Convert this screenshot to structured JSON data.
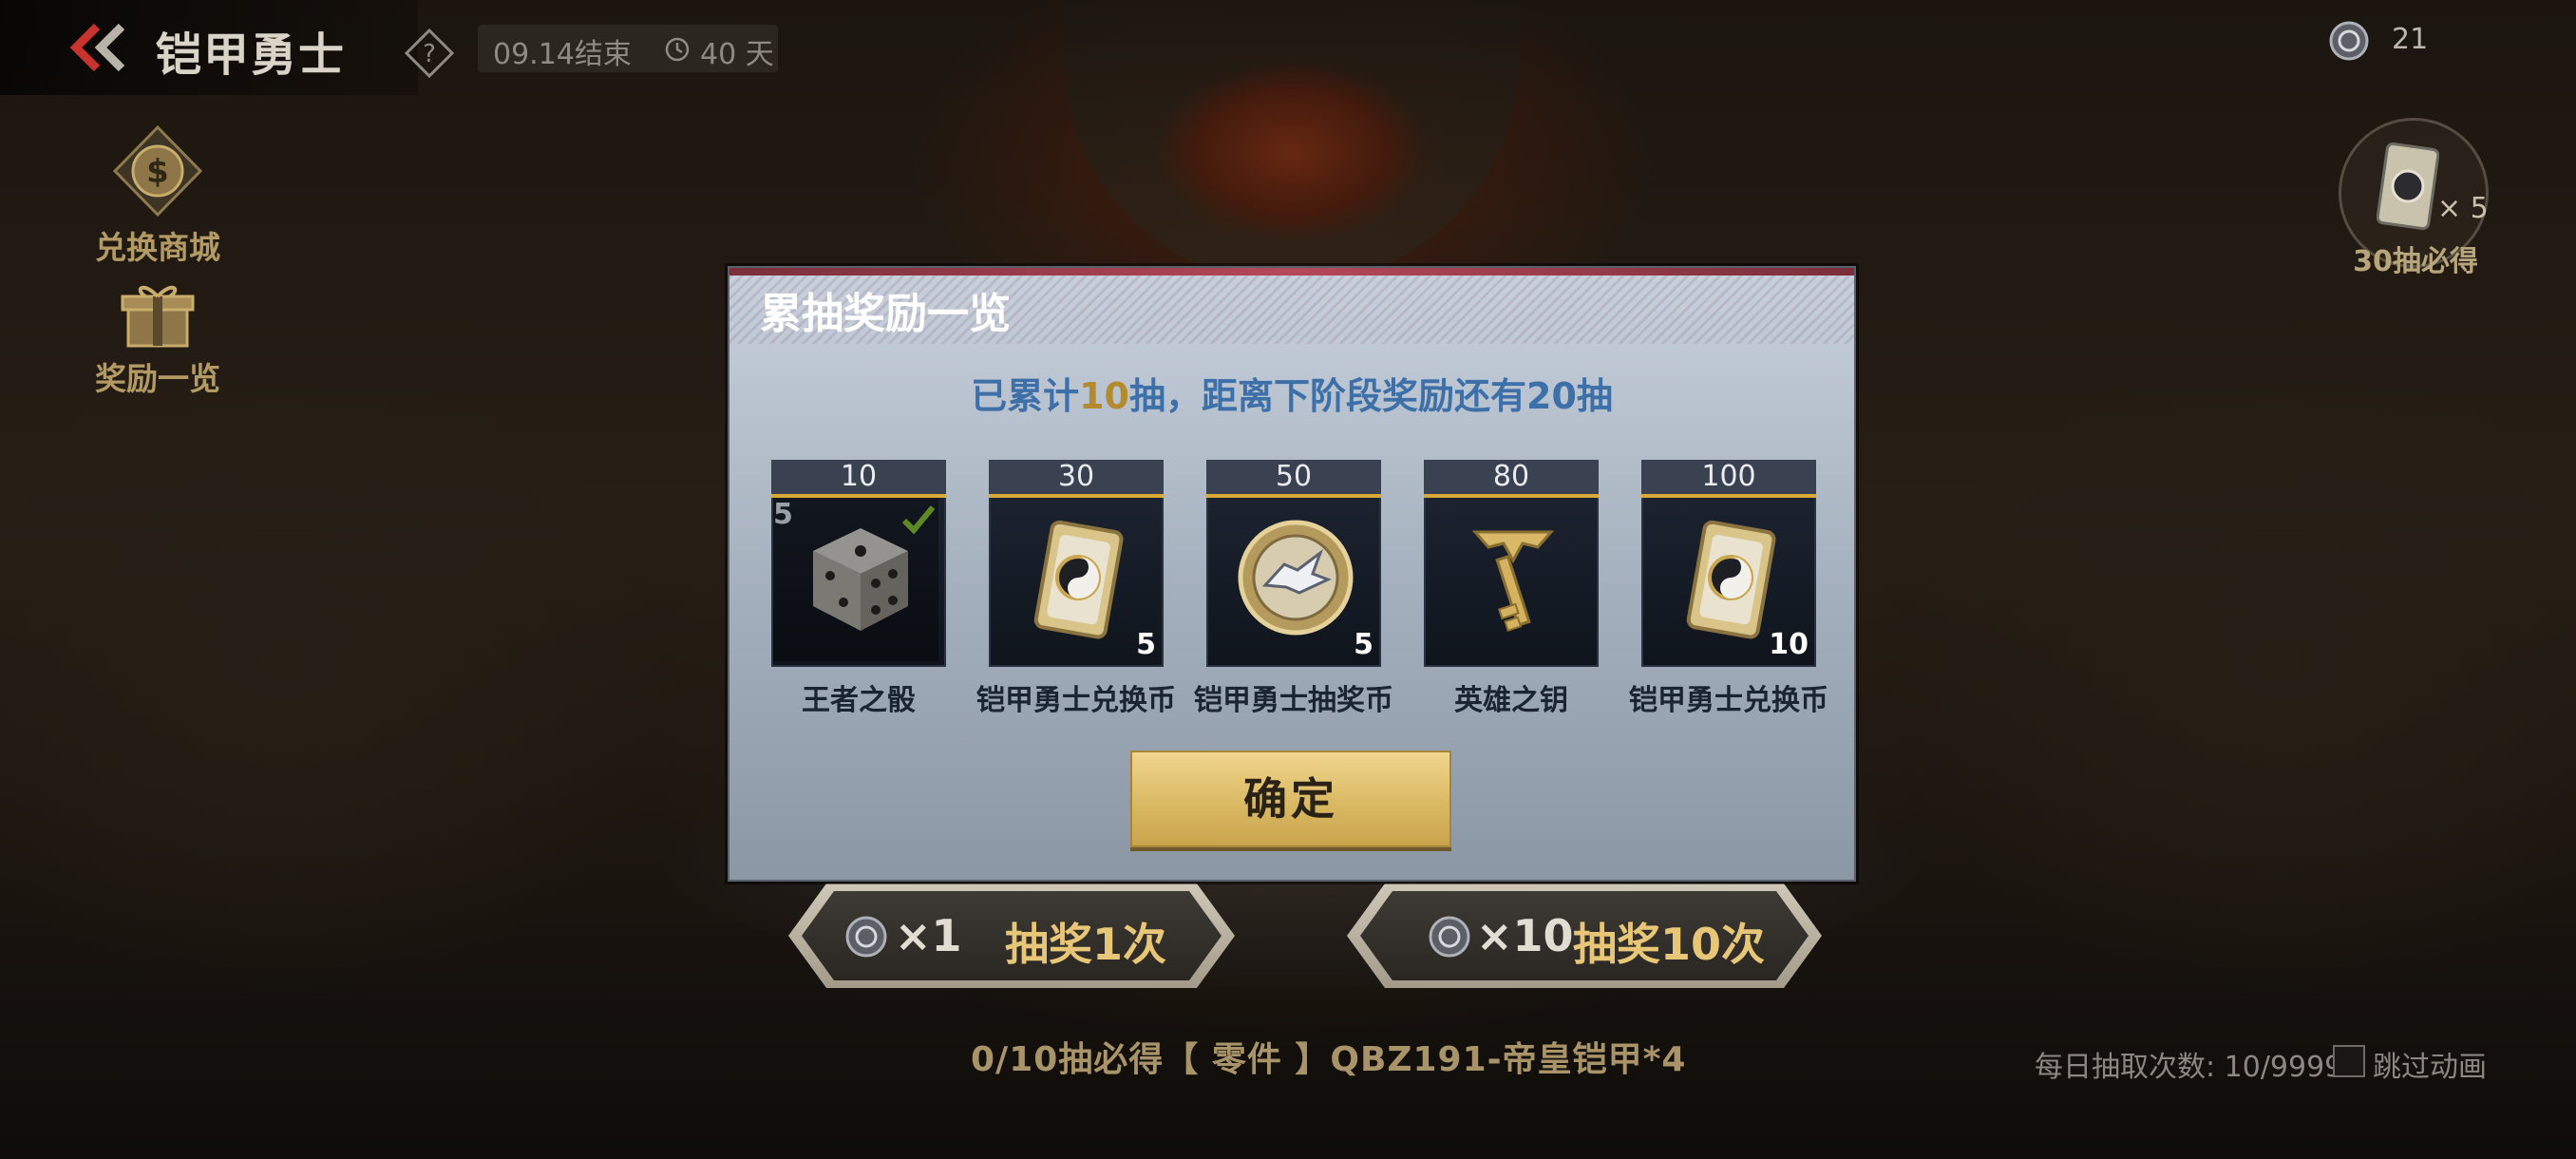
{
  "header": {
    "title": "铠甲勇士",
    "end_date": "09.14结束",
    "days_left": "40 天",
    "currency_count": "21"
  },
  "side_menu": {
    "shop_label": "兑换商城",
    "rewards_label": "奖励一览"
  },
  "pity": {
    "count": "× 5",
    "label": "30抽必得"
  },
  "draw_buttons": {
    "single_mult": "×1",
    "single_label": "抽奖1次",
    "ten_mult": "×10",
    "ten_label": "抽奖10次"
  },
  "footer": {
    "guarantee": "0/10抽必得【 零件 】QBZ191-帝皇铠甲*4",
    "daily_count": "每日抽取次数: 10/9999",
    "skip_label": "跳过动画"
  },
  "modal": {
    "title": "累抽奖励一览",
    "progress_prefix": "已累计",
    "progress_count": "10",
    "progress_suffix": "抽，距离下阶段奖励还有20抽",
    "confirm_label": "确定",
    "rewards": [
      {
        "threshold": "10",
        "name": "王者之骰",
        "qty": "5",
        "claimed": true,
        "icon": "dice-icon"
      },
      {
        "threshold": "30",
        "name": "铠甲勇士兑换币",
        "qty": "5",
        "claimed": false,
        "icon": "exchange-coin-card-icon"
      },
      {
        "threshold": "50",
        "name": "铠甲勇士抽奖币",
        "qty": "5",
        "claimed": false,
        "icon": "lottery-coin-icon"
      },
      {
        "threshold": "80",
        "name": "英雄之钥",
        "qty": "",
        "claimed": false,
        "icon": "hero-key-icon"
      },
      {
        "threshold": "100",
        "name": "铠甲勇士兑换币",
        "qty": "10",
        "claimed": false,
        "icon": "exchange-coin-card-icon"
      }
    ]
  },
  "colors": {
    "gold_accent": "#d9a93a",
    "progress_blue": "#3d6fa8",
    "side_label": "#b39a64",
    "confirm_gold": "#e0c170"
  }
}
